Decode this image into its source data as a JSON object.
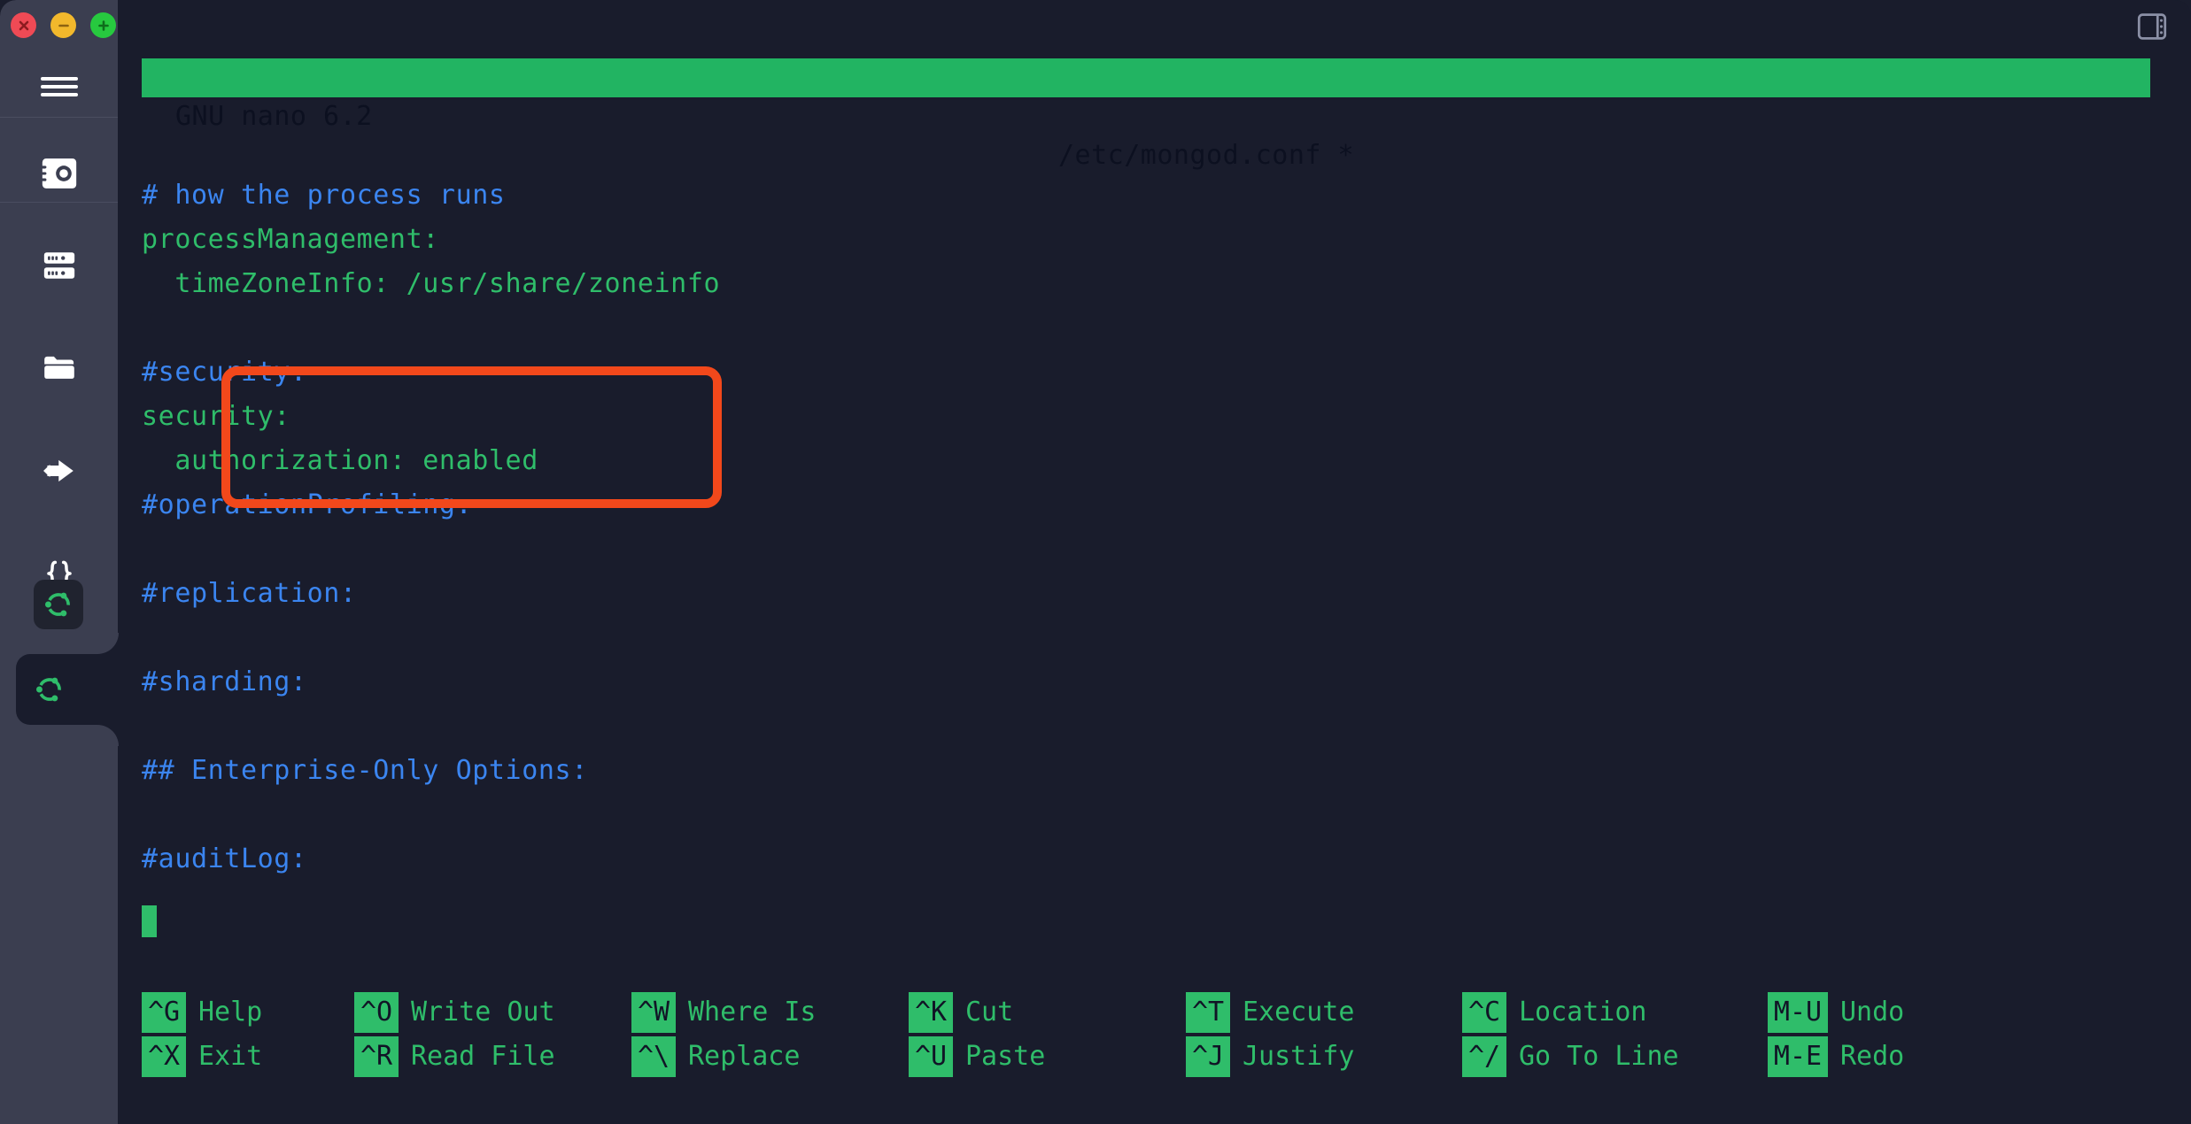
{
  "window": {
    "traffic_lights": [
      {
        "name": "close",
        "glyph": "×",
        "color": "#ef4a55"
      },
      {
        "name": "minimize",
        "glyph": "−",
        "color": "#f2b82c"
      },
      {
        "name": "maximize",
        "glyph": "+",
        "color": "#27c93f"
      }
    ],
    "panel_toggle_icon": "panel-layout-icon"
  },
  "sidebar": {
    "menu_icon": "hamburger-menu-icon",
    "items": [
      {
        "icon": "vault-icon",
        "label": "Vault"
      },
      {
        "icon": "server-stack-icon",
        "label": "Servers"
      },
      {
        "icon": "folder-icon",
        "label": "Folders"
      },
      {
        "icon": "forward-arrow-icon",
        "label": "Transfer"
      },
      {
        "icon": "curly-braces-icon",
        "label": "Snippets"
      }
    ],
    "app_tile_icon": "ubuntu-logo-icon",
    "active_tab_icon": "ubuntu-logo-icon"
  },
  "nano": {
    "version_label": "GNU nano 6.2",
    "file_label": "/etc/mongod.conf *",
    "modified_marker": "*",
    "cursor": {
      "line": 12,
      "column": 1
    },
    "lines": [
      {
        "text": "# how the process runs",
        "type": "comment",
        "indent": 0
      },
      {
        "text": "processManagement:",
        "type": "key",
        "indent": 0
      },
      {
        "text": "  timeZoneInfo: /usr/share/zoneinfo",
        "type": "key",
        "indent": 0
      },
      {
        "text": "",
        "type": "blank",
        "indent": 0
      },
      {
        "text": "#security:",
        "type": "comment",
        "indent": 0
      },
      {
        "text": "security:",
        "type": "key",
        "indent": 0
      },
      {
        "text": "  authorization: enabled",
        "type": "key",
        "indent": 0
      },
      {
        "text": "#operationProfiling:",
        "type": "comment",
        "indent": 0
      },
      {
        "text": "",
        "type": "blank",
        "indent": 0
      },
      {
        "text": "#replication:",
        "type": "comment",
        "indent": 0
      },
      {
        "text": "",
        "type": "blank",
        "indent": 0
      },
      {
        "text": "#sharding:",
        "type": "comment",
        "indent": 0
      },
      {
        "text": "",
        "type": "blank",
        "indent": 0
      },
      {
        "text": "## Enterprise-Only Options:",
        "type": "comment",
        "indent": 0
      },
      {
        "text": "",
        "type": "blank",
        "indent": 0
      },
      {
        "text": "#auditLog:",
        "type": "comment",
        "indent": 0
      }
    ],
    "highlight": {
      "name": "security-block-highlight",
      "color": "#f2481b",
      "covers": [
        "#security:",
        "security:",
        "  authorization: enabled"
      ]
    },
    "shortcuts": [
      [
        {
          "key": "^G",
          "label": "Help"
        },
        {
          "key": "^X",
          "label": "Exit"
        }
      ],
      [
        {
          "key": "^O",
          "label": "Write Out"
        },
        {
          "key": "^R",
          "label": "Read File"
        }
      ],
      [
        {
          "key": "^W",
          "label": "Where Is"
        },
        {
          "key": "^\\",
          "label": "Replace"
        }
      ],
      [
        {
          "key": "^K",
          "label": "Cut"
        },
        {
          "key": "^U",
          "label": "Paste"
        }
      ],
      [
        {
          "key": "^T",
          "label": "Execute"
        },
        {
          "key": "^J",
          "label": "Justify"
        }
      ],
      [
        {
          "key": "^C",
          "label": "Location"
        },
        {
          "key": "^/",
          "label": "Go To Line"
        }
      ],
      [
        {
          "key": "M-U",
          "label": "Undo"
        },
        {
          "key": "M-E",
          "label": "Redo"
        }
      ]
    ]
  },
  "colors": {
    "terminal_bg": "#191c2c",
    "sidebar_bg": "#3b3e50",
    "nano_green": "#22b462",
    "text_green": "#2fbd6a",
    "comment_blue": "#3b85f0",
    "highlight_orange": "#f2481b"
  }
}
